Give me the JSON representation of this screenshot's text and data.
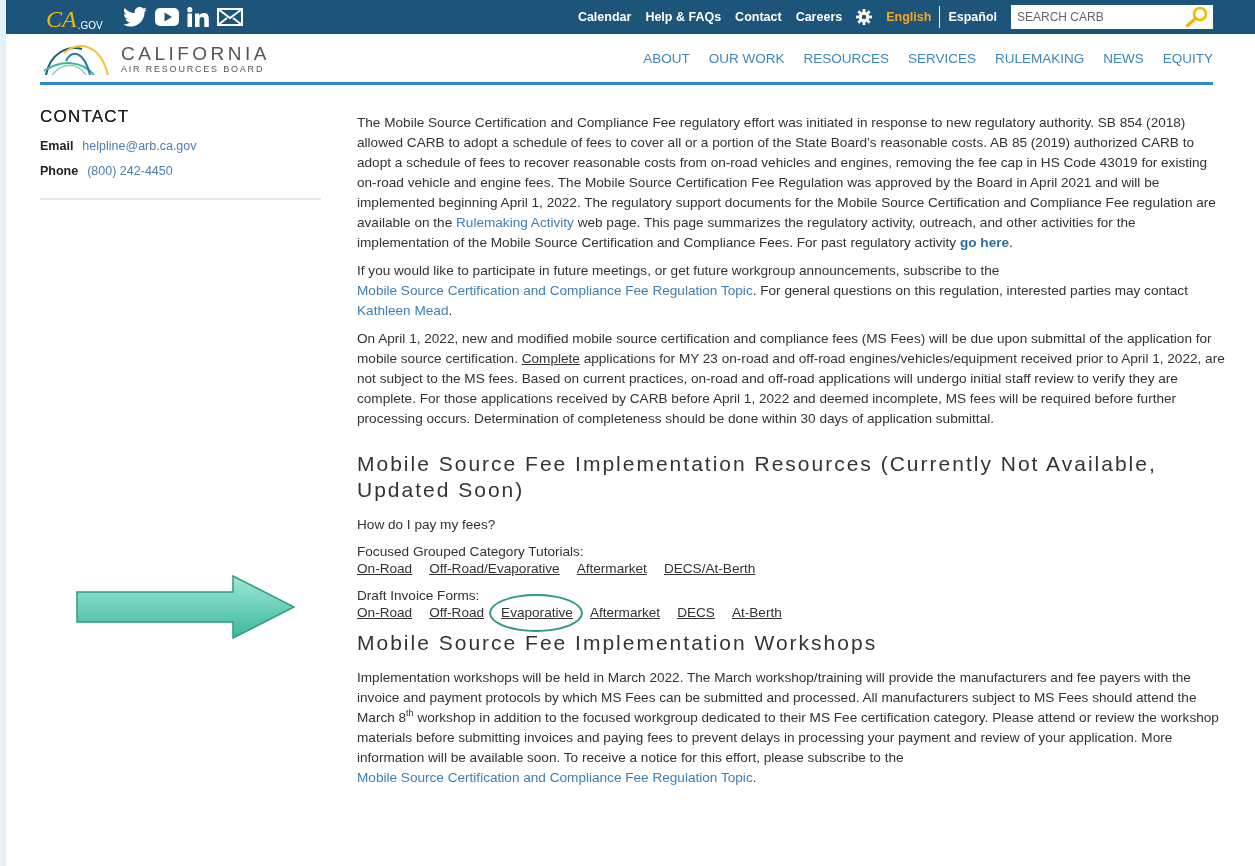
{
  "top_bar": {
    "logo": {
      "main": "CA",
      "suffix": ".GOV"
    },
    "social": [
      {
        "kind": "twitter"
      },
      {
        "kind": "youtube"
      },
      {
        "kind": "linkedin"
      },
      {
        "kind": "email"
      }
    ],
    "links": [
      {
        "label": "Calendar"
      },
      {
        "label": "Help & FAQs"
      },
      {
        "label": "Contact"
      },
      {
        "label": "Careers"
      }
    ],
    "languages": [
      {
        "label": "English",
        "selected": true
      },
      {
        "label": "Español",
        "selected": false
      }
    ],
    "search": {
      "placeholder": "SEARCH CARB"
    }
  },
  "brand": {
    "name": "CALIFORNIA",
    "subtitle": "AIR RESOURCES BOARD"
  },
  "nav": [
    "ABOUT",
    "OUR WORK",
    "RESOURCES",
    "SERVICES",
    "RULEMAKING",
    "NEWS",
    "EQUITY"
  ],
  "sidebar": {
    "title": "CONTACT",
    "rows": [
      {
        "label": "Email",
        "value": "helpline@arb.ca.gov"
      },
      {
        "label": "Phone",
        "value": "(800) 242-4450"
      }
    ]
  },
  "paragraphs": [
    [
      {
        "kind": "text",
        "text": "The Mobile Source Certification and Compliance Fee regulatory effort was initiated in response to new regulatory authority. SB 854 (2018) allowed CARB to adopt a schedule of fees to cover all or a portion of the State Board’s reasonable costs. AB 85 (2019) authorized CARB to adopt a schedule of fees to recover reasonable costs from on-road vehicles and engines, removing the fee cap in HS Code 43019 for existing on-road vehicle and engine fees. The Mobile Source Certification Fee Regulation was approved by the Board in April 2021 and will be implemented beginning April 1, 2022. The regulatory support documents for the Mobile Source Certification and Compliance Fee regulation are available on the "
      },
      {
        "kind": "link",
        "text": "Rulemaking Activity"
      },
      {
        "kind": "text",
        "text": " web page. This page summarizes the regulatory activity, outreach, and other activities for the implementation of the Mobile Source Certification and Compliance Fees. For past regulatory activity "
      },
      {
        "kind": "bold_link",
        "text": "go here"
      },
      {
        "kind": "text",
        "text": "."
      }
    ],
    [
      {
        "kind": "text",
        "text": "If you would like to participate in future meetings, or get future workgroup announcements, subscribe to the "
      },
      {
        "kind": "link",
        "text": "Mobile Source Certification and Compliance Fee Regulation Topic"
      },
      {
        "kind": "text",
        "text": ". For general questions on this regulation, interested parties may contact "
      },
      {
        "kind": "link",
        "text": "Kathleen Mead"
      },
      {
        "kind": "text",
        "text": "."
      }
    ],
    [
      {
        "kind": "text",
        "text": "On April 1, 2022, new and modified mobile source certification and compliance fees (MS Fees) will be due upon submittal of the application for mobile source certification. "
      },
      {
        "kind": "underlined",
        "text": "Complete"
      },
      {
        "kind": "text",
        "text": " applications for MY 23 on-road and off-road engines/vehicles/equipment received prior to April 1, 2022, are not subject to the MS fees. Based on current practices, on-road and off-road applications will undergo initial staff review to verify they are complete.  For those applications received by CARB before April 1, 2022 and deemed incomplete, MS fees will be required before further processing occurs. Determination of completeness should be done within 30 days of application submittal."
      }
    ]
  ],
  "resources": {
    "heading": "Mobile Source Fee Implementation Resources (Currently Not Available, Updated Soon)",
    "question": "How do I pay my fees?",
    "groups": [
      {
        "title": "Focused Grouped Category Tutorials:",
        "callout_arrow": false,
        "links": [
          {
            "label": "On-Road",
            "circled": false
          },
          {
            "label": "Off-Road/Evaporative",
            "circled": false
          },
          {
            "label": "Aftermarket",
            "circled": false
          },
          {
            "label": "DECS/At-Berth",
            "circled": false
          }
        ]
      },
      {
        "title": "Draft Invoice Forms:",
        "callout_arrow": true,
        "links": [
          {
            "label": "On-Road",
            "circled": false
          },
          {
            "label": "Off-Road",
            "circled": false
          },
          {
            "label": "Evaporative",
            "circled": true
          },
          {
            "label": "Aftermarket",
            "circled": false
          },
          {
            "label": "DECS",
            "circled": false
          },
          {
            "label": "At-Berth",
            "circled": false
          }
        ]
      }
    ]
  },
  "workshops": {
    "heading": "Mobile Source Fee Implementation Workshops",
    "paragraph": [
      {
        "kind": "text",
        "text": "Implementation workshops will be held in March 2022. The March workshop/training will provide the manufacturers and fee payers with the invoice and payment protocols by which MS Fees can be submitted and processed. All manufacturers subject to MS Fees should attend the March 8"
      },
      {
        "kind": "sup",
        "text": "th"
      },
      {
        "kind": "text",
        "text": " workshop in addition to the focused workgroup dedicated to their MS Fee certification category. Please attend or review the workshop materials before submitting invoices and paying fees to prevent delays in processing your payment and review of your application. More information will be available soon. To receive a notice for this effort, please subscribe to the "
      },
      {
        "kind": "link",
        "text": "Mobile Source Certification and Compliance Fee Regulation Topic"
      },
      {
        "kind": "text",
        "text": "."
      }
    ]
  }
}
